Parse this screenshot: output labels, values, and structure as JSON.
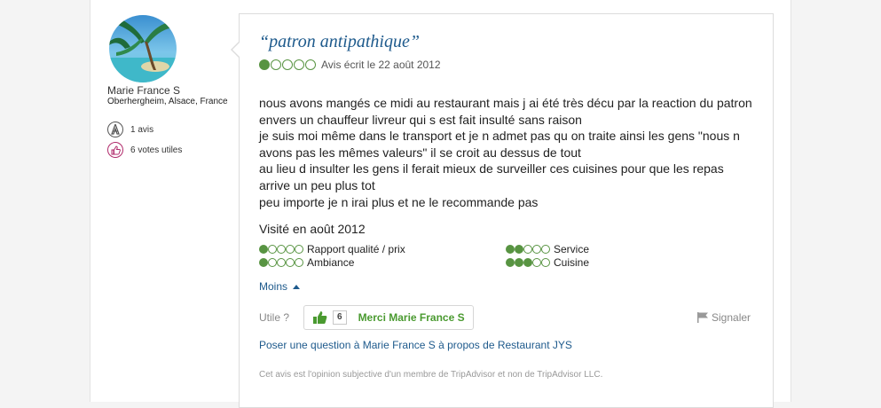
{
  "member": {
    "name": "Marie France S",
    "location": "Oberhergheim, Alsace, France",
    "reviews_badge": "1 avis",
    "helpful_badge": "6 votes utiles"
  },
  "review": {
    "title": "“patron antipathique”",
    "rating": 1,
    "rating_max": 5,
    "date": "Avis écrit le 22 août 2012",
    "lines": [
      "nous avons mangés ce midi au restaurant mais j ai été très décu par la reaction du patron",
      "envers un chauffeur livreur qui s est fait insulté sans raison",
      "je suis moi même dans le transport et je n admet pas qu on traite ainsi les gens \"nous n",
      "avons pas les mêmes valeurs\" il se croit au dessus de tout",
      "au lieu d insulter les gens il ferait mieux de surveiller ces cuisines pour que les repas",
      "arrive un peu plus tot",
      "peu importe je n irai plus et ne le recommande pas"
    ],
    "visited": "Visité en août 2012",
    "subratings": [
      {
        "label": "Rapport qualité / prix",
        "value": 1
      },
      {
        "label": "Service",
        "value": 2
      },
      {
        "label": "Ambiance",
        "value": 1
      },
      {
        "label": "Cuisine",
        "value": 3
      }
    ],
    "less_label": "Moins",
    "helpful_label": "Utile ?",
    "thanks_count": "6",
    "thanks_label": "Merci Marie France S",
    "report_label": "Signaler",
    "ask_link": "Poser une question à Marie France S à propos de Restaurant JYS",
    "disclaimer": "Cet avis est l'opinion subjective d'un membre de TripAdvisor et non de TripAdvisor LLC."
  },
  "colors": {
    "link": "#1e5a8c",
    "bubble_green": "#589442",
    "thanks_green": "#4a9a30"
  }
}
